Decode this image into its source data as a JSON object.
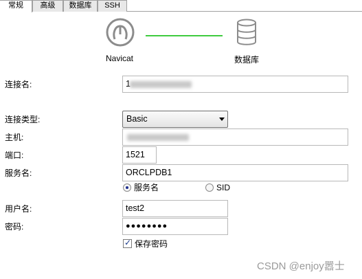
{
  "tabs": [
    {
      "label": "常规",
      "active": true
    },
    {
      "label": "高级",
      "active": false
    },
    {
      "label": "数据库",
      "active": false
    },
    {
      "label": "SSH",
      "active": false
    }
  ],
  "header": {
    "left_label": "Navicat",
    "right_label": "数据库",
    "link_color": "#3ecb3e"
  },
  "form": {
    "connection_name": {
      "label": "连接名:",
      "value": "1"
    },
    "connection_type": {
      "label": "连接类型:",
      "value": "Basic"
    },
    "host": {
      "label": "主机:",
      "value": ""
    },
    "port": {
      "label": "端口:",
      "value": "1521"
    },
    "service_name": {
      "label": "服务名:",
      "value": "ORCLPDB1"
    },
    "service_mode": {
      "option_service": "服务名",
      "option_sid": "SID",
      "selected": "服务名"
    },
    "username": {
      "label": "用户名:",
      "value": "test2"
    },
    "password": {
      "label": "密码:",
      "value": "●●●●●●●●"
    },
    "save_password": {
      "label": "保存密码",
      "checked": true
    }
  },
  "watermark": "CSDN @enjoy嚣士"
}
